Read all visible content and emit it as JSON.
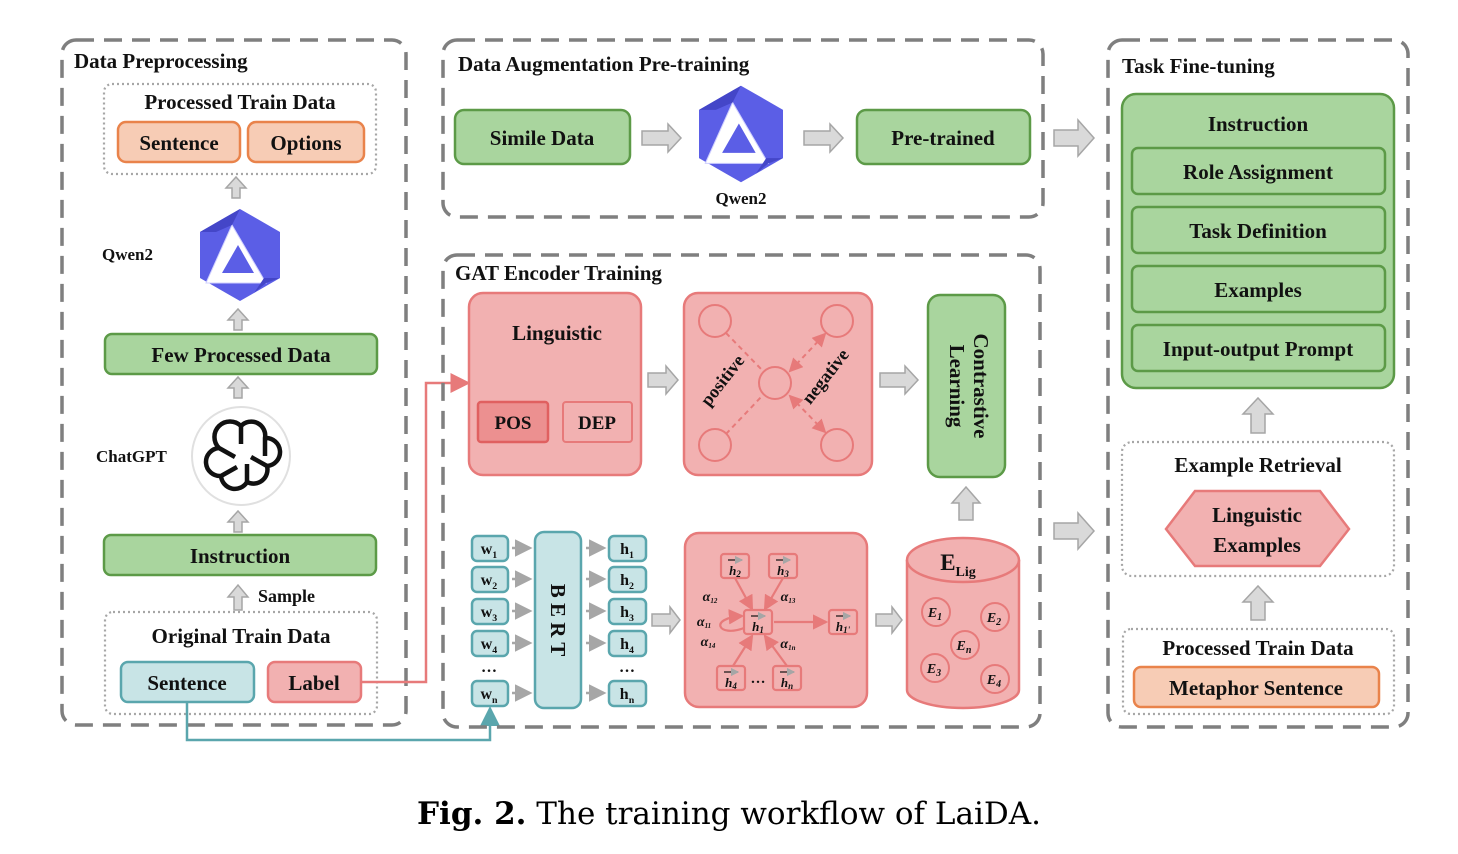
{
  "colors": {
    "green_fill": "#a9d59e",
    "green_stroke": "#5c9a47",
    "pink_fill": "#f2b1b1",
    "pink_stroke": "#e77a7a",
    "pink_dark_fill": "#ec9090",
    "orange_fill": "#f7ccb5",
    "orange_stroke": "#e9834b",
    "teal_fill": "#c8e4e6",
    "teal_stroke": "#5aa6ad",
    "qwen_blue": "#5b5ee6",
    "arrow_fill": "#d9d9d9",
    "arrow_stroke": "#a6a6a6",
    "dash_gray": "#7f7f7f"
  },
  "preprocessing": {
    "title": "Data Preprocessing",
    "processed_train_data": {
      "title": "Processed Train Data",
      "items": [
        "Sentence",
        "Options"
      ]
    },
    "qwen_label": "Qwen2",
    "few_processed": "Few Processed Data",
    "chatgpt_label": "ChatGPT",
    "instruction": "Instruction",
    "sample_label": "Sample",
    "original_train_data": {
      "title": "Original Train Data",
      "sentence": "Sentence",
      "label": "Label"
    }
  },
  "augmentation": {
    "title": "Data Augmentation Pre-training",
    "simile_data": "Simile Data",
    "qwen_label": "Qwen2",
    "pretrained": "Pre-trained"
  },
  "gat": {
    "title": "GAT Encoder Training",
    "linguistic": "Linguistic",
    "pos": "POS",
    "dep": "DEP",
    "positive": "positive",
    "negative": "negative",
    "contrastive": [
      "Contrastive",
      "Learning"
    ],
    "bert": "B E R T",
    "words": [
      "w1",
      "w2",
      "w3",
      "w4",
      "…",
      "wn"
    ],
    "hidden": [
      "h1",
      "h2",
      "h3",
      "h4",
      "…",
      "hn"
    ],
    "attention": {
      "nodes": [
        "h2",
        "h3",
        "h1",
        "h1'",
        "h4",
        "…",
        "hn"
      ],
      "weights": [
        "α12",
        "α13",
        "α11",
        "α14",
        "α1n"
      ]
    },
    "store": {
      "title": "E",
      "subscript": "Lig",
      "items": [
        "E1",
        "E2",
        "En",
        "E3",
        "E4"
      ]
    }
  },
  "finetune": {
    "title": "Task Fine-tuning",
    "instruction_title": "Instruction",
    "instruction_items": [
      "Role Assignment",
      "Task Definition",
      "Examples",
      "Input-output Prompt"
    ],
    "retrieval_title": "Example Retrieval",
    "linguistic_examples": [
      "Linguistic",
      "Examples"
    ],
    "processed_title": "Processed Train Data",
    "metaphor_sentence": "Metaphor Sentence"
  },
  "caption": {
    "label": "Fig. 2.",
    "text": " The training workflow of LaiDA."
  }
}
